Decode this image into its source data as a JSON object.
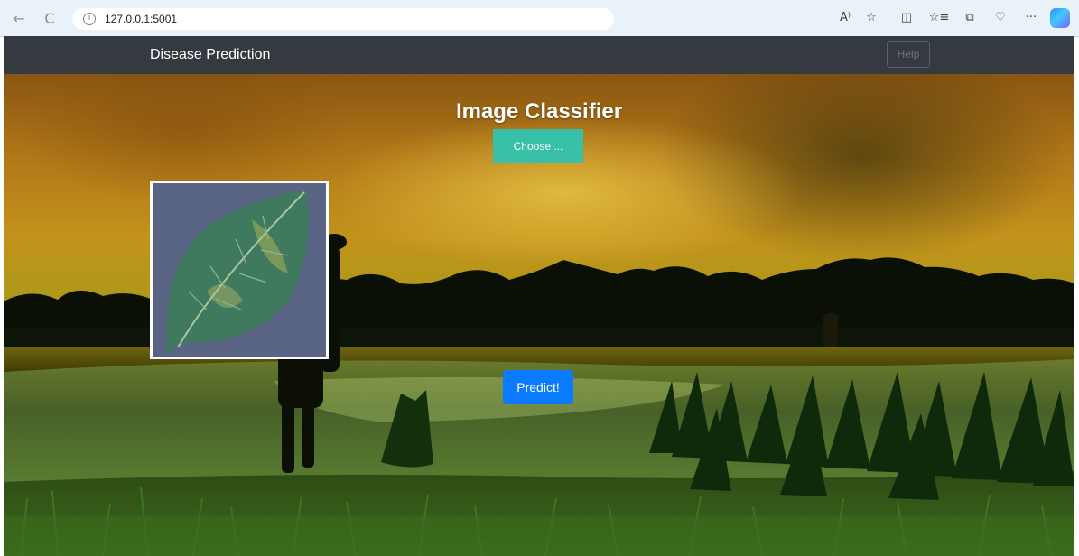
{
  "browser": {
    "url": "127.0.0.1:5001",
    "back_icon": "←",
    "reload_icon": "C",
    "info_icon": "i",
    "toolbar_icons": [
      "A⁾",
      "☆",
      "◫",
      "☆≡",
      "⧉",
      "♡",
      "···"
    ]
  },
  "navbar": {
    "brand": "Disease Prediction",
    "help_label": "Help"
  },
  "main": {
    "title": "Image Classifier",
    "choose_label": "Choose ...",
    "predict_label": "Predict!"
  },
  "colors": {
    "navbar_bg": "#343a40",
    "choose_btn": "#39c0a8",
    "predict_btn": "#0a7bff"
  }
}
